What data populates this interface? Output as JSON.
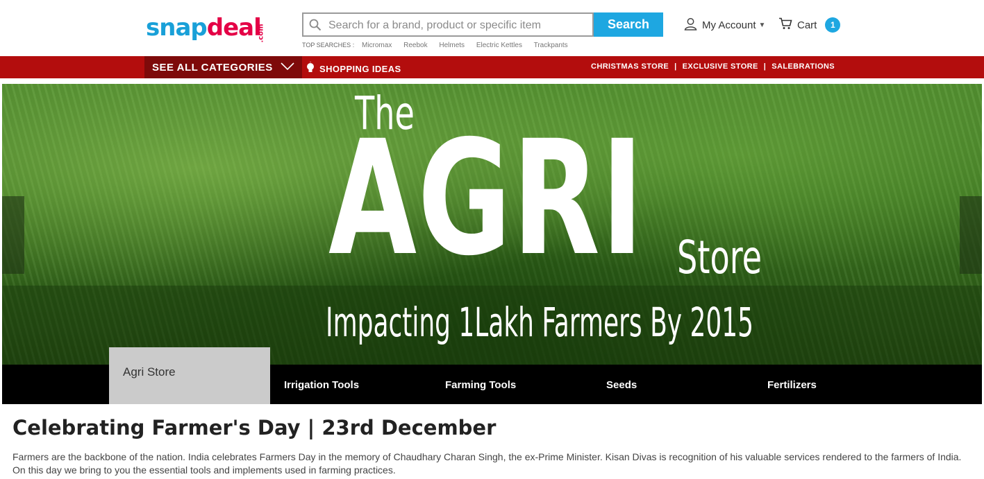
{
  "header": {
    "logo": {
      "main_left": "snap",
      "main_right": "deal",
      "suffix": ".com"
    },
    "search": {
      "placeholder": "Search for a brand, product or specific item",
      "button_label": "Search"
    },
    "top_searches": {
      "label": "TOP SEARCHES :",
      "items": [
        "Micromax",
        "Reebok",
        "Helmets",
        "Electric Kettles",
        "Trackpants"
      ]
    },
    "account_label": "My Account",
    "cart_label": "Cart",
    "cart_count": "1"
  },
  "navbar": {
    "see_all": "SEE ALL CATEGORIES",
    "shopping_ideas": "SHOPPING IDEAS",
    "links": [
      "CHRISTMAS STORE",
      "EXCLUSIVE STORE",
      "SALEBRATIONS"
    ]
  },
  "banner": {
    "line1": "The",
    "line2": "AGRI",
    "line3": "Store",
    "tagline": "Impacting 1Lakh Farmers By 2015"
  },
  "tabs": [
    {
      "label": "Agri Store",
      "active": true
    },
    {
      "label": "Irrigation Tools",
      "active": false
    },
    {
      "label": "Farming Tools",
      "active": false
    },
    {
      "label": "Seeds",
      "active": false
    },
    {
      "label": "Fertilizers",
      "active": false
    }
  ],
  "content": {
    "heading": "Celebrating Farmer's Day | 23rd December",
    "description": "Farmers are the backbone of the nation. India celebrates Farmers Day in the memory of Chaudhary Charan Singh, the ex-Prime Minister. Kisan Divas is recognition of his valuable services rendered to the farmers of India. On this day we bring to you the essential tools and implements used in farming practices."
  },
  "colors": {
    "brand_blue": "#1ea7e1",
    "brand_red": "#e40046",
    "nav_red": "#b30d0d",
    "nav_dark_red": "#7e0a0a"
  },
  "icons": [
    "search-icon",
    "user-icon",
    "cart-icon",
    "chevron-down-icon",
    "bulb-icon",
    "arrow-left-icon",
    "arrow-right-icon"
  ]
}
